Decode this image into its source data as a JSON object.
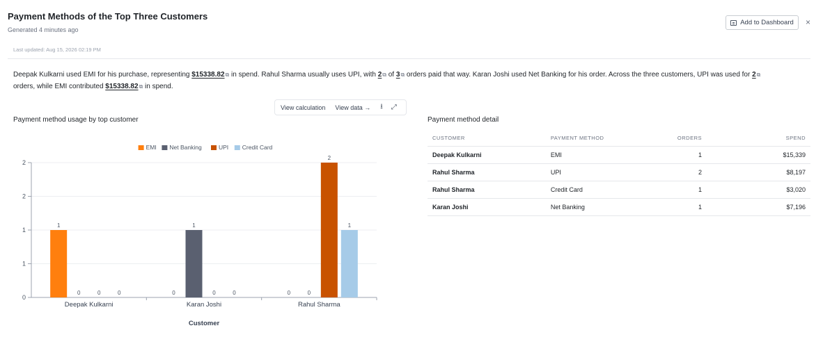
{
  "header": {
    "title": "Payment Methods of the Top Three Customers",
    "generated": "Generated 4 minutes ago",
    "add_to_dashboard": "Add to Dashboard",
    "close": "×"
  },
  "last_updated": "Last updated: Aug 15, 2026 02:19 PM",
  "summary": {
    "p1": "Deepak Kulkarni used EMI for his purchase, representing ",
    "v1": "$15338.82",
    "p2": " in spend. Rahul Sharma usually uses UPI, with ",
    "v2": "2",
    "p3": " of ",
    "v3": "3",
    "p4": " orders paid that way. Karan Joshi used Net Banking for his order. Across the three customers, UPI was used for ",
    "v4": "2",
    "p5": " orders, while EMI contributed ",
    "v5": "$15338.82",
    "p6": " in spend."
  },
  "toolbar": {
    "view_calculation": "View calculation",
    "view_data": "View data →",
    "download_icon": "⭳",
    "expand_icon": "⤢"
  },
  "chart_title": "Payment method usage by top customer",
  "chart_data": {
    "type": "bar",
    "categories": [
      "Deepak Kulkarni",
      "Karan Joshi",
      "Rahul Sharma"
    ],
    "series": [
      {
        "name": "EMI",
        "values": [
          1,
          0,
          0
        ],
        "color": "#ff7f0e"
      },
      {
        "name": "Net Banking",
        "values": [
          0,
          1,
          0
        ],
        "color": "#5a6070"
      },
      {
        "name": "UPI",
        "values": [
          0,
          0,
          2
        ],
        "color": "#c85200"
      },
      {
        "name": "Credit Card",
        "values": [
          0,
          0,
          1
        ],
        "color": "#a6cbe8"
      }
    ],
    "xlabel": "Customer",
    "ylabel": "",
    "ylim": [
      0,
      2
    ],
    "yticks": [
      0,
      0.5,
      1,
      1.5,
      2
    ],
    "ytick_labels": [
      "0",
      "1",
      "1",
      "2",
      "2"
    ],
    "legend": "top-center",
    "grid": true
  },
  "table": {
    "title": "Payment method detail",
    "columns": [
      "CUSTOMER",
      "PAYMENT METHOD",
      "ORDERS",
      "SPEND"
    ],
    "rows": [
      {
        "customer": "Deepak Kulkarni",
        "method": "EMI",
        "orders": "1",
        "spend": "$15,339"
      },
      {
        "customer": "Rahul Sharma",
        "method": "UPI",
        "orders": "2",
        "spend": "$8,197"
      },
      {
        "customer": "Rahul Sharma",
        "method": "Credit Card",
        "orders": "1",
        "spend": "$3,020"
      },
      {
        "customer": "Karan Joshi",
        "method": "Net Banking",
        "orders": "1",
        "spend": "$7,196"
      }
    ]
  }
}
